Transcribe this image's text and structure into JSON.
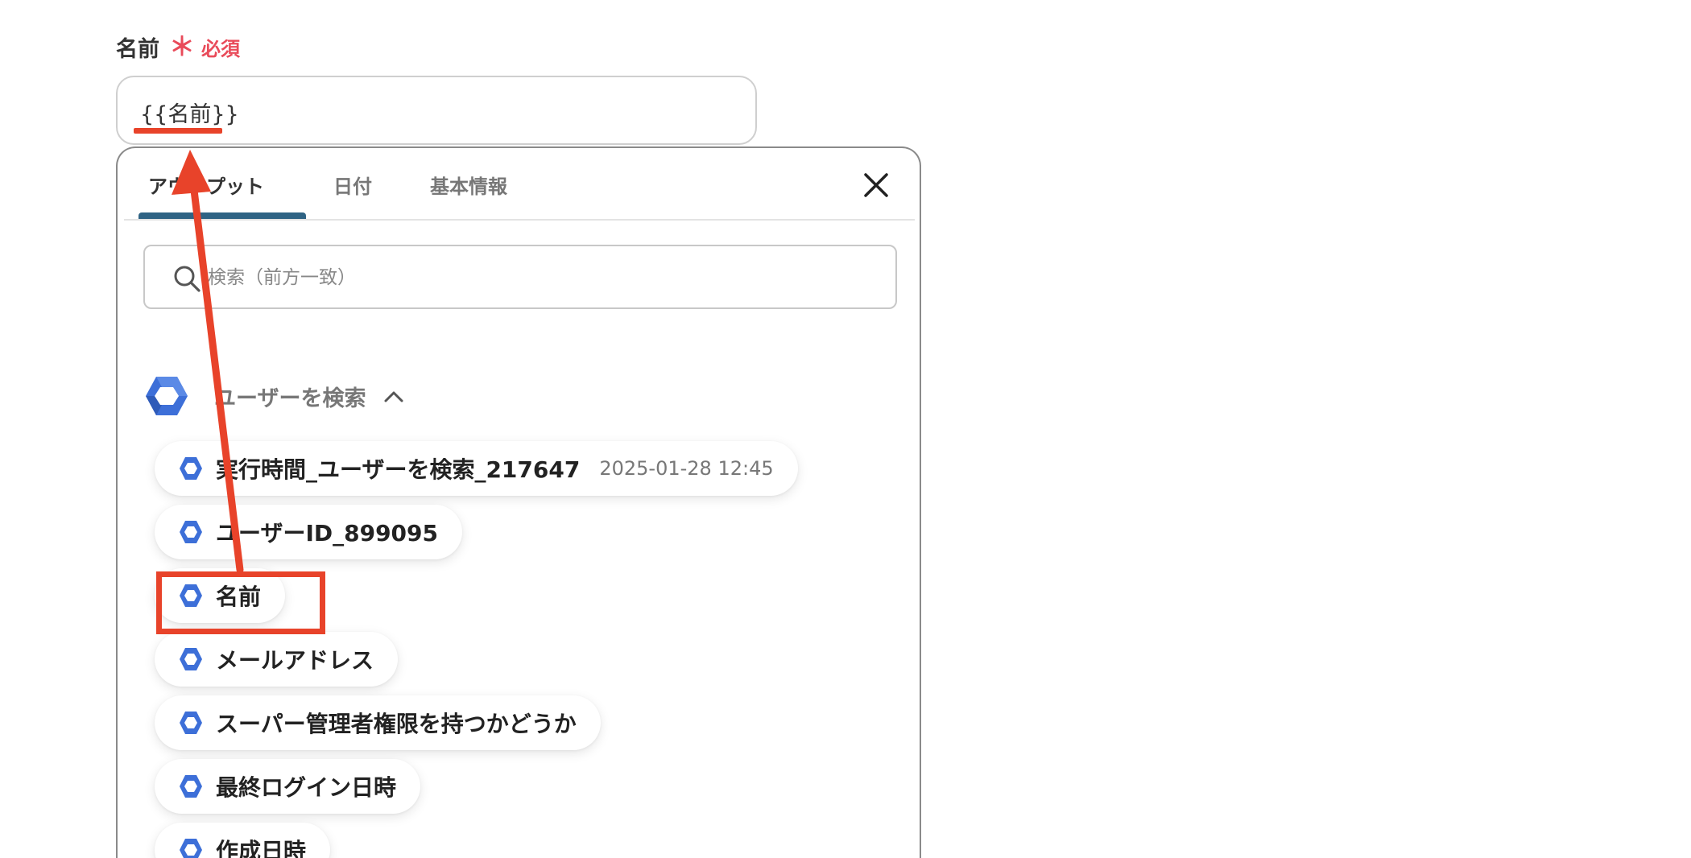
{
  "field": {
    "label": "名前",
    "required_star": "＊",
    "required_text": "必須",
    "value": "{{名前}}"
  },
  "tabs": [
    {
      "label": "アウトプット",
      "active": true
    },
    {
      "label": "日付",
      "active": false
    },
    {
      "label": "基本情報",
      "active": false
    }
  ],
  "search": {
    "placeholder": "検索（前方一致）"
  },
  "section": {
    "title": "ユーザーを検索",
    "icon": "google-workspace-hexagon-icon",
    "expanded": true
  },
  "items": [
    {
      "label": "実行時間_ユーザーを検索_217647",
      "meta": "2025-01-28 12:45"
    },
    {
      "label": "ユーザーID_899095",
      "meta": ""
    },
    {
      "label": "名前",
      "meta": ""
    },
    {
      "label": "メールアドレス",
      "meta": ""
    },
    {
      "label": "スーパー管理者権限を持つかどうか",
      "meta": ""
    },
    {
      "label": "最終ログイン日時",
      "meta": ""
    },
    {
      "label": "作成日時",
      "meta": ""
    }
  ],
  "colors": {
    "accent_tab": "#2f6384",
    "required": "#e94b5a",
    "annotation": "#e8432a",
    "hex_blue_dark": "#3d6fd8",
    "hex_blue_light": "#7aa6f2"
  },
  "icons": {
    "close": "close-icon",
    "search": "search-icon",
    "chevron": "chevron-up-icon"
  }
}
